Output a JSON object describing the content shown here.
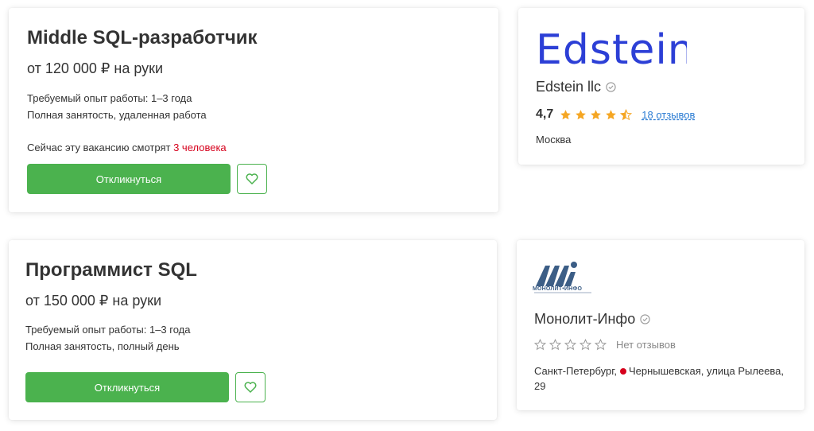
{
  "vacancy1": {
    "title": "Middle SQL-разработчик",
    "salary": "от 120 000 ₽ на руки",
    "experience": "Требуемый опыт работы: 1–3 года",
    "employment": "Полная занятость, удаленная работа",
    "watching_prefix": "Сейчас эту вакансию смотрят ",
    "watching_count": "3 человека",
    "apply_label": "Откликнуться"
  },
  "company1": {
    "logo_text": "Edstein",
    "name": "Edstein llc",
    "rating": "4,7",
    "rating_value": 4.7,
    "reviews": "18 отзывов",
    "city": "Москва"
  },
  "vacancy2": {
    "title": "Программист SQL",
    "salary": "от 150 000 ₽ на руки",
    "experience": "Требуемый опыт работы: 1–3 года",
    "employment": "Полная занятость, полный день",
    "apply_label": "Откликнуться"
  },
  "company2": {
    "logo_text": "МОНОЛИТ•ИНФО",
    "name": "Монолит-Инфо",
    "reviews": "Нет отзывов",
    "city": "Санкт-Петербург,",
    "metro": "Чернышевская, улица Рылеева,",
    "house": "29"
  },
  "colors": {
    "accent": "#4bb24e",
    "link": "#2b7cd3",
    "star": "#f5a623",
    "metro": "#d6001c"
  }
}
